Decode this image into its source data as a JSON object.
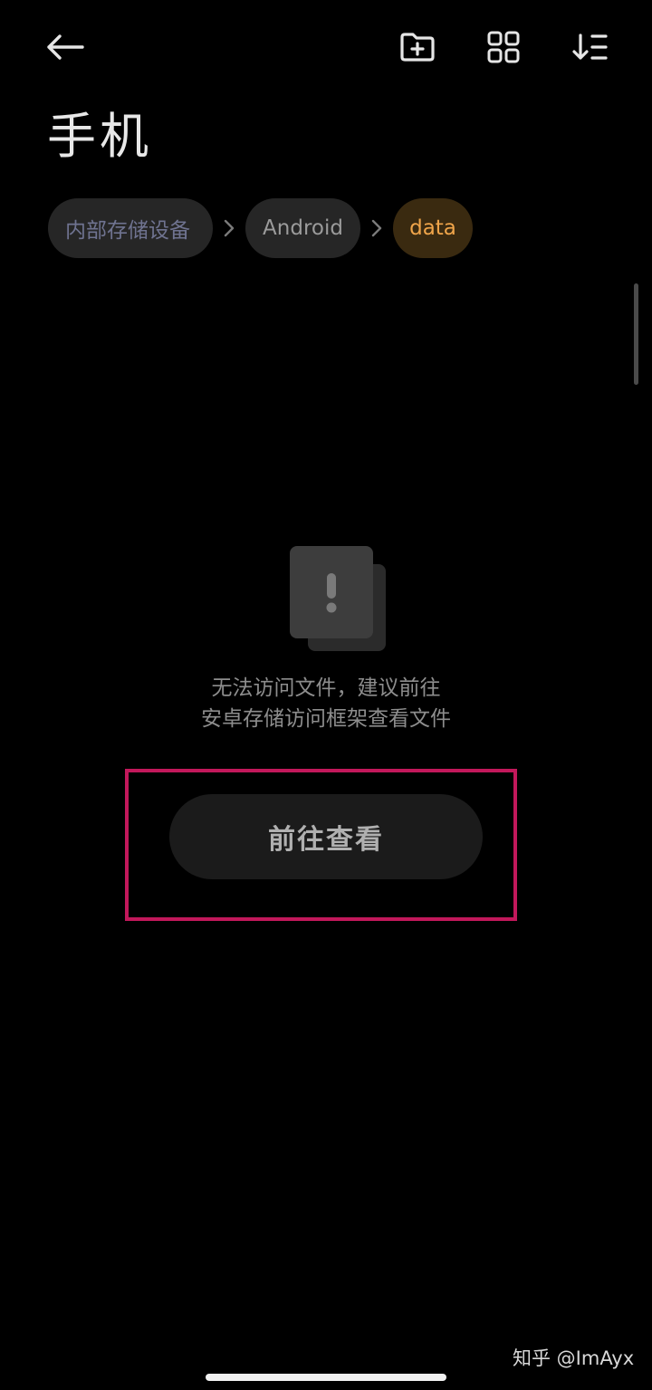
{
  "header": {
    "title": "手机",
    "icons": {
      "back": "arrow-left-icon",
      "new_folder": "folder-plus-icon",
      "grid_view": "grid-icon",
      "sort": "sort-icon"
    }
  },
  "breadcrumb": {
    "items": [
      {
        "label": "内部存储设备"
      },
      {
        "label": "Android"
      },
      {
        "label": "data"
      }
    ],
    "separator_icon": "chevron-right-icon"
  },
  "empty_state": {
    "icon": "warning-icon",
    "message_line1": "无法访问文件，建议前往",
    "message_line2": "安卓存储访问框架查看文件",
    "button_label": "前往查看"
  },
  "watermark": {
    "text": "知乎 @ImAyx"
  },
  "colors": {
    "background": "#000000",
    "accent": "#f0a54a",
    "accent_bg": "#3a2a10",
    "highlight_border": "#c2185b",
    "chip_bg": "#262626"
  }
}
